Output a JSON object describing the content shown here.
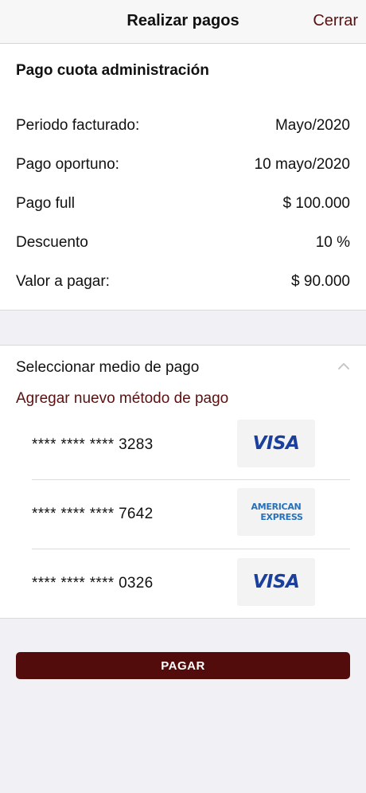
{
  "nav": {
    "title": "Realizar pagos",
    "close_label": "Cerrar"
  },
  "summary": {
    "title": "Pago cuota administración",
    "rows": [
      {
        "label": "Periodo facturado:",
        "value": "Mayo/2020"
      },
      {
        "label": "Pago oportuno:",
        "value": "10 mayo/2020"
      },
      {
        "label": "Pago full",
        "value": "$ 100.000"
      },
      {
        "label": "Descuento",
        "value": "10 %"
      },
      {
        "label": "Valor a pagar:",
        "value": "$ 90.000"
      }
    ]
  },
  "methods": {
    "header": "Seleccionar medio de pago",
    "add_label": "Agregar nuevo método de pago",
    "cards": [
      {
        "number": "**** **** **** 3283",
        "brand": "VISA"
      },
      {
        "number": "**** **** **** 7642",
        "brand_line1": "AMERICAN",
        "brand_line2": "EXPRESS"
      },
      {
        "number": "**** **** **** 0326",
        "brand": "VISA"
      }
    ]
  },
  "pay_button_label": "PAGAR",
  "colors": {
    "accent": "#5a1010",
    "button": "#530c0c",
    "visa": "#1a3f9c",
    "amex": "#2671b9"
  }
}
